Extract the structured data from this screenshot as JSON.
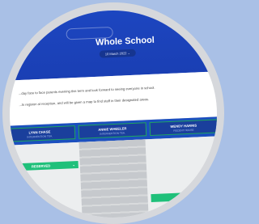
{
  "header": {
    "title": "Whole School",
    "date": "10 March 2022"
  },
  "banner": {
    "line1": "...day face to face parents evening this term and look forward to seeing everyone in school.",
    "line2": "...ts register at reception, and will be given a map to find staff in their designated areas."
  },
  "teachers": [
    {
      "name": "LYNN CHASE",
      "role": "INTERVENTION TEA."
    },
    {
      "name": "ANNIE WHEELER",
      "role": "INTERVENTION TEA."
    },
    {
      "name": "WENDY HARRIS",
      "role": "RECENT HOUSE"
    }
  ],
  "slots": {
    "reserved_label": "RESERVED",
    "reserved_arrow": "⌄"
  },
  "colors": {
    "accent": "#1d47c2",
    "reserved": "#1fc07a",
    "background": "#a9c0e6"
  }
}
